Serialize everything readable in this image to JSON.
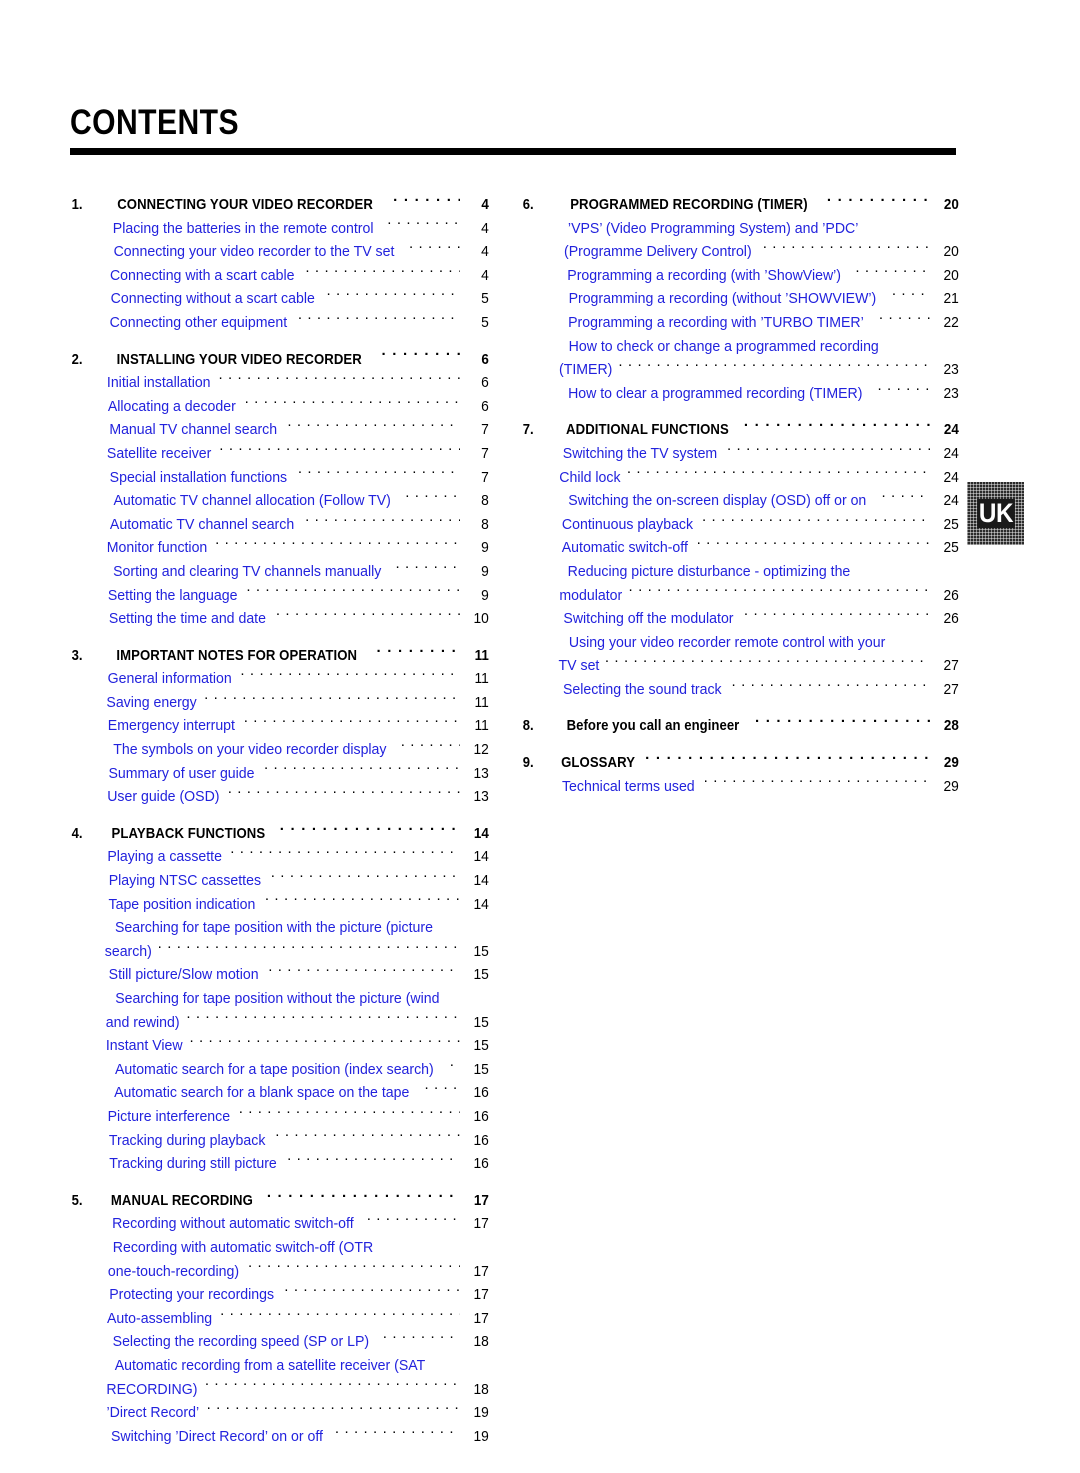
{
  "document": {
    "title": "CONTENTS",
    "language_tab": "UK"
  },
  "colors": {
    "entry_blue": "#2222dd",
    "heading_black": "#000000",
    "tab_background": "#2b2b2b"
  },
  "columns": {
    "left": [
      {
        "number": "1.",
        "heading": {
          "label": "CONNECTING YOUR VIDEO RECORDER",
          "page": "4"
        },
        "entries": [
          {
            "label": "Placing the batteries in the remote control",
            "page": "4"
          },
          {
            "label": "Connecting your video recorder to the TV set",
            "page": "4"
          },
          {
            "label": "Connecting with a scart cable",
            "page": "4"
          },
          {
            "label": "Connecting without a scart cable",
            "page": "5"
          },
          {
            "label": "Connecting other equipment",
            "page": "5"
          }
        ]
      },
      {
        "number": "2.",
        "heading": {
          "label": "INSTALLING YOUR VIDEO RECORDER",
          "page": "6"
        },
        "entries": [
          {
            "label": "Initial installation",
            "page": "6"
          },
          {
            "label": "Allocating a decoder",
            "page": "6"
          },
          {
            "label": "Manual TV channel search",
            "page": "7"
          },
          {
            "label": "Satellite receiver",
            "page": "7"
          },
          {
            "label": "Special installation functions",
            "page": "7"
          },
          {
            "label": "Automatic TV channel allocation (Follow TV)",
            "page": "8"
          },
          {
            "label": "Automatic TV channel search",
            "page": "8"
          },
          {
            "label": "Monitor function",
            "page": "9"
          },
          {
            "label": "Sorting and clearing TV channels manually",
            "page": "9"
          },
          {
            "label": "Setting the language",
            "page": "9"
          },
          {
            "label": "Setting the time and date",
            "page": "10"
          }
        ]
      },
      {
        "number": "3.",
        "heading": {
          "label": "IMPORTANT NOTES FOR OPERATION",
          "page": "11"
        },
        "entries": [
          {
            "label": "General information",
            "page": "11"
          },
          {
            "label": "Saving energy",
            "page": "11"
          },
          {
            "label": "Emergency interrupt",
            "page": "11"
          },
          {
            "label": "The symbols on your video recorder display",
            "page": "12"
          },
          {
            "label": "Summary of user guide",
            "page": "13"
          },
          {
            "label": "User guide (OSD)",
            "page": "13"
          }
        ]
      },
      {
        "number": "4.",
        "heading": {
          "label": "PLAYBACK FUNCTIONS",
          "page": "14"
        },
        "entries": [
          {
            "label": "Playing a cassette",
            "page": "14"
          },
          {
            "label": "Playing NTSC cassettes",
            "page": "14"
          },
          {
            "label": "Tape position indication",
            "page": "14"
          },
          {
            "label": "Searching for tape position with the picture (picture",
            "page": "",
            "wrap": true
          },
          {
            "label": "search)",
            "page": "15"
          },
          {
            "label": "Still picture/Slow motion",
            "page": "15"
          },
          {
            "label": "Searching for tape position without the picture (wind",
            "page": "",
            "wrap": true
          },
          {
            "label": "and rewind)",
            "page": "15"
          },
          {
            "label": "Instant View",
            "page": "15"
          },
          {
            "label": "Automatic search for a tape position (index search)",
            "page": "15"
          },
          {
            "label": "Automatic search for a blank space on the tape",
            "page": "16"
          },
          {
            "label": "Picture interference",
            "page": "16"
          },
          {
            "label": "Tracking during playback",
            "page": "16"
          },
          {
            "label": "Tracking during still picture",
            "page": "16"
          }
        ]
      },
      {
        "number": "5.",
        "heading": {
          "label": "MANUAL RECORDING",
          "page": "17"
        },
        "entries": [
          {
            "label": "Recording without automatic switch-off",
            "page": "17"
          },
          {
            "label": "Recording with automatic switch-off (OTR",
            "page": "",
            "wrap": true
          },
          {
            "label": "one-touch-recording)",
            "page": "17"
          },
          {
            "label": "Protecting your recordings",
            "page": "17"
          },
          {
            "label": "Auto-assembling",
            "page": "17"
          },
          {
            "label": "Selecting the recording speed (SP or LP)",
            "page": "18"
          },
          {
            "label": "Automatic recording from a satellite receiver (SAT",
            "page": "",
            "wrap": true
          },
          {
            "label": "RECORDING)",
            "page": "18"
          },
          {
            "label": "’Direct Record’",
            "page": "19"
          },
          {
            "label": "Switching ’Direct Record’ on or off",
            "page": "19"
          }
        ]
      }
    ],
    "right": [
      {
        "number": "6.",
        "heading": {
          "label": "PROGRAMMED RECORDING (TIMER)",
          "page": "20"
        },
        "entries": [
          {
            "label": "’VPS’ (Video Programming System) and ’PDC’",
            "page": "",
            "wrap": true
          },
          {
            "label": "(Programme Delivery Control)",
            "page": "20"
          },
          {
            "label": "Programming a recording (with ’ShowView’)",
            "page": "20"
          },
          {
            "label": "Programming a recording (without ’SHOWVIEW’)",
            "page": "21"
          },
          {
            "label": "Programming a recording with ’TURBO TIMER’",
            "page": "22"
          },
          {
            "label": "How to check or change a programmed recording",
            "page": "",
            "wrap": true
          },
          {
            "label": "(TIMER)",
            "page": "23"
          },
          {
            "label": "How to clear a programmed recording (TIMER)",
            "page": "23"
          }
        ]
      },
      {
        "number": "7.",
        "heading": {
          "label": "ADDITIONAL FUNCTIONS",
          "page": "24"
        },
        "entries": [
          {
            "label": "Switching the TV system",
            "page": "24"
          },
          {
            "label": "Child lock",
            "page": "24"
          },
          {
            "label": "Switching the on-screen display (OSD) off or on",
            "page": "24"
          },
          {
            "label": "Continuous playback",
            "page": "25"
          },
          {
            "label": "Automatic switch-off",
            "page": "25"
          },
          {
            "label": "Reducing picture disturbance - optimizing the",
            "page": "",
            "wrap": true
          },
          {
            "label": "modulator",
            "page": "26"
          },
          {
            "label": "Switching off the modulator",
            "page": "26"
          },
          {
            "label": "Using your video recorder remote control with your",
            "page": "",
            "wrap": true
          },
          {
            "label": "TV set",
            "page": "27"
          },
          {
            "label": "Selecting the sound track",
            "page": "27"
          }
        ]
      },
      {
        "number": "8.",
        "heading": {
          "label": "Before you call an engineer",
          "page": "28",
          "mixed_case": true
        },
        "entries": []
      },
      {
        "number": "9.",
        "heading": {
          "label": "GLOSSARY",
          "page": "29"
        },
        "entries": [
          {
            "label": "Technical terms used",
            "page": "29"
          }
        ]
      }
    ]
  }
}
